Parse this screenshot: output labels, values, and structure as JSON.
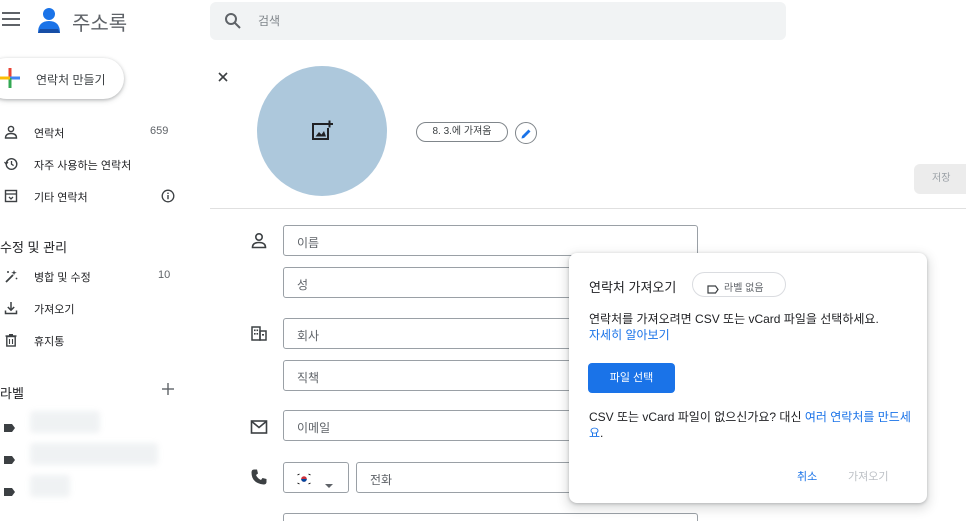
{
  "header": {
    "app_title": "주소록",
    "search_placeholder": "검색"
  },
  "sidebar": {
    "create_label": "연락처 만들기",
    "items": [
      {
        "label": "연락처",
        "count": "659",
        "icon": "person-icon"
      },
      {
        "label": "자주 사용하는 연락처",
        "count": "",
        "icon": "history-icon"
      },
      {
        "label": "기타 연락처",
        "count": "",
        "icon": "archive-icon"
      }
    ],
    "manage_title": "수정 및 관리",
    "manage_items": [
      {
        "label": "병합 및 수정",
        "count": "10",
        "icon": "magic-wand-icon"
      },
      {
        "label": "가져오기",
        "count": "",
        "icon": "download-icon"
      },
      {
        "label": "휴지통",
        "count": "",
        "icon": "trash-icon"
      }
    ],
    "labels_title": "라벨"
  },
  "editor": {
    "label_chip": "8. 3.에 가져옴",
    "save_label": "저장",
    "fields": {
      "first_name": "이름",
      "last_name": "성",
      "company": "회사",
      "job_title": "직책",
      "email": "이메일",
      "phone": "전화"
    }
  },
  "dialog": {
    "title": "연락처 가져오기",
    "chip_label": "라벨 없음",
    "body_text": "연락처를 가져오려면 CSV 또는 vCard 파일을 선택하세요.",
    "learn_more": "자세히 알아보기",
    "file_button": "파일 선택",
    "no_file_text": "CSV 또는 vCard 파일이 없으신가요? 대신 ",
    "create_link": "여러 연락처를 만드세요",
    "period": ".",
    "cancel": "취소",
    "import": "가져오기"
  },
  "colors": {
    "accent": "#1a73e8",
    "avatar_bg": "#adc8dc",
    "search_bg": "#f1f3f4"
  }
}
